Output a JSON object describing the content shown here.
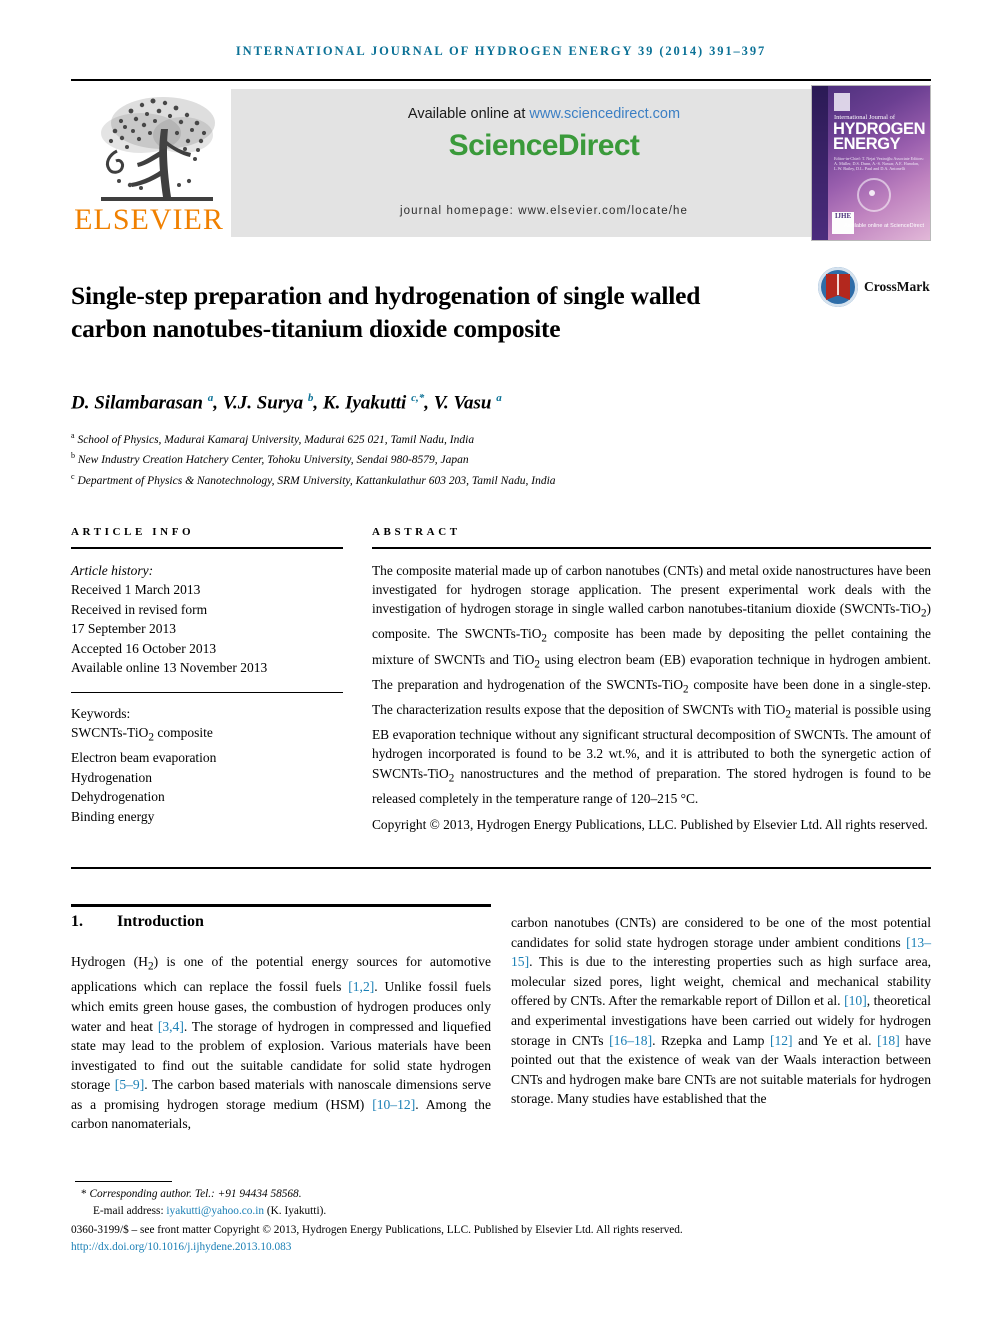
{
  "running_head": "INTERNATIONAL JOURNAL OF HYDROGEN ENERGY 39 (2014) 391–397",
  "masthead": {
    "available_prefix": "Available online at ",
    "available_url": "www.sciencedirect.com",
    "sciencedirect_logo": "ScienceDirect",
    "journal_homepage": "journal homepage: www.elsevier.com/locate/he",
    "publisher_logo_text": "ELSEVIER",
    "cover": {
      "line1": "International Journal of",
      "line2": "HYDROGEN",
      "line3": "ENERGY",
      "editors": "Editor-in-Chief: T. Nejat Veziroğlu   Associate Editors: A. Müller, D.S. Dunn, A.-S. Nassar, A.E. Hamdan, L.W. Bailey, D.L. Paul and D.A. Antonelli",
      "spine_mark": "IJHE",
      "sciencedirect_badge": "Available online at ScienceDirect"
    }
  },
  "title": "Single-step preparation and hydrogenation of single walled carbon nanotubes-titanium dioxide composite",
  "crossmark_label": "CrossMark",
  "authors_html": "D. Silambarasan <sup>a</sup>, V.J. Surya <sup>b</sup>, K. Iyakutti <sup>c,*</sup>, V. Vasu <sup>a</sup>",
  "affiliations": [
    {
      "marker": "a",
      "text": "School of Physics, Madurai Kamaraj University, Madurai 625 021, Tamil Nadu, India"
    },
    {
      "marker": "b",
      "text": "New Industry Creation Hatchery Center, Tohoku University, Sendai 980-8579, Japan"
    },
    {
      "marker": "c",
      "text": "Department of Physics & Nanotechnology, SRM University, Kattankulathur 603 203, Tamil Nadu, India"
    }
  ],
  "article_info": {
    "heading": "ARTICLE INFO",
    "history_label": "Article history:",
    "history": [
      "Received 1 March 2013",
      "Received in revised form",
      "17 September 2013",
      "Accepted 16 October 2013",
      "Available online 13 November 2013"
    ],
    "keywords_label": "Keywords:",
    "keywords_html": [
      "SWCNTs-TiO<sub>2</sub> composite",
      "Electron beam evaporation",
      "Hydrogenation",
      "Dehydrogenation",
      "Binding energy"
    ]
  },
  "abstract": {
    "heading": "ABSTRACT",
    "body_html": "The composite material made up of carbon nanotubes (CNTs) and metal oxide nanostructures have been investigated for hydrogen storage application. The present experimental work deals with the investigation of hydrogen storage in single walled carbon nanotubes-titanium dioxide (SWCNTs-TiO<sub>2</sub>) composite. The SWCNTs-TiO<sub>2</sub> composite has been made by depositing the pellet containing the mixture of SWCNTs and TiO<sub>2</sub> using electron beam (EB) evaporation technique in hydrogen ambient. The preparation and hydrogenation of the SWCNTs-TiO<sub>2</sub> composite have been done in a single-step. The characterization results expose that the deposition of SWCNTs with TiO<sub>2</sub> material is possible using EB evaporation technique without any significant structural decomposition of SWCNTs. The amount of hydrogen incorporated is found to be 3.2 wt.%, and it is attributed to both the synergetic action of SWCNTs-TiO<sub>2</sub> nanostructures and the method of preparation. The stored hydrogen is found to be released completely in the temperature range of 120–215 °C.",
    "copyright": "Copyright © 2013, Hydrogen Energy Publications, LLC. Published by Elsevier Ltd. All rights reserved."
  },
  "section": {
    "number": "1.",
    "title": "Introduction"
  },
  "body": {
    "left_html": "Hydrogen (H<sub>2</sub>) is one of the potential energy sources for automotive applications which can replace the fossil fuels <span class=\"ref\">[1,2]</span>. Unlike fossil fuels which emits green house gases, the combustion of hydrogen produces only water and heat <span class=\"ref\">[3,4]</span>. The storage of hydrogen in compressed and liquefied state may lead to the problem of explosion. Various materials have been investigated to find out the suitable candidate for solid state hydrogen storage <span class=\"ref\">[5–9]</span>. The carbon based materials with nanoscale dimensions serve as a promising hydrogen storage medium (HSM) <span class=\"ref\">[10–12]</span>. Among the carbon nanomaterials,",
    "right_html": "carbon nanotubes (CNTs) are considered to be one of the most potential candidates for solid state hydrogen storage under ambient conditions <span class=\"ref\">[13–15]</span>. This is due to the interesting properties such as high surface area, molecular sized pores, light weight, chemical and mechanical stability offered by CNTs. After the remarkable report of Dillon et al. <span class=\"ref\">[10]</span>, theoretical and experimental investigations have been carried out widely for hydrogen storage in CNTs <span class=\"ref\">[16–18]</span>. Rzepka and Lamp <span class=\"ref\">[12]</span> and Ye et al. <span class=\"ref\">[18]</span> have pointed out that the existence of weak van der Waals interaction between CNTs and hydrogen make bare CNTs are not suitable materials for hydrogen storage. Many studies have established that the"
  },
  "footer": {
    "corresponding_star": "*",
    "corresponding": "Corresponding author. Tel.: +91 94434 58568.",
    "email_label": "E-mail address: ",
    "email": "iyakutti@yahoo.co.in",
    "email_owner": " (K. Iyakutti).",
    "issn_line": "0360-3199/$ – see front matter Copyright © 2013, Hydrogen Energy Publications, LLC. Published by Elsevier Ltd. All rights reserved.",
    "doi": "http://dx.doi.org/10.1016/j.ijhydene.2013.10.083"
  },
  "colors": {
    "header_teal": "#0b7196",
    "link_blue": "#1a7fb5",
    "sciencedirect_green": "#3a9a3a",
    "elsevier_orange": "#f08000",
    "crossmark_blue": "#2e6da8",
    "crossmark_red": "#b3281e"
  }
}
